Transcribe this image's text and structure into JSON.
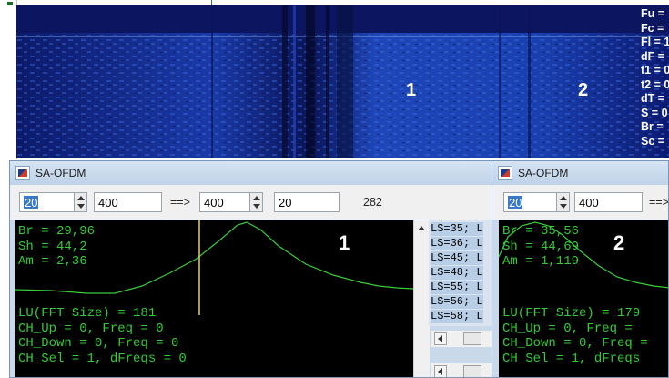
{
  "spectrogram": {
    "labels": [
      "1",
      "2"
    ],
    "readouts": [
      "Fu =",
      "Fc =",
      "Fl = 1",
      "dF =",
      "t1 = 0",
      "t2 = 0",
      "dT =",
      "S = 0",
      "Br =",
      "Sc ="
    ]
  },
  "window1": {
    "title": "SA-OFDM",
    "spin1_value": "20",
    "field2_value": "400",
    "arrow_text": "==>",
    "spin3_value": "400",
    "field4_value": "20",
    "count": "282",
    "scope": {
      "label": "1",
      "lines_top": [
        "Br = 29,96",
        "Sh = 44,2",
        "Am = 2,36"
      ],
      "lines_bottom": [
        "LU(FFT Size) = 181",
        "CH_Up = 0, Freq = 0",
        "CH_Down = 0, Freq = 0",
        "CH_Sel = 1, dFreqs = 0"
      ]
    },
    "ls_list": [
      "LS=35; L",
      "LS=36; L",
      "LS=45; L",
      "LS=48; L",
      "LS=55; L",
      "LS=56; L",
      "LS=58; L"
    ]
  },
  "window2": {
    "title": "SA-OFDM",
    "spin1_value": "20",
    "field2_value": "400",
    "arrow_text": "==>",
    "scope": {
      "label": "2",
      "lines_top": [
        "Br = 35,56",
        "Sh = 44,69",
        "Am = 1,119"
      ],
      "lines_bottom": [
        "LU(FFT Size) = 179",
        "CH_Up = 0, Freq =",
        "CH_Down = 0, Freq =",
        "CH_Sel = 1, dFreqs"
      ]
    }
  },
  "colors": {
    "scope_text": "#33cc33",
    "spectrogram_bg": "#0a1150",
    "window_title_bar": "#c9d9ea"
  }
}
